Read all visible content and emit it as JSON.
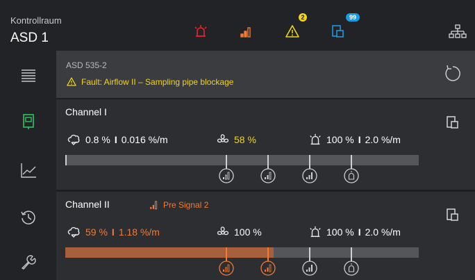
{
  "header": {
    "location": "Kontrollraum",
    "device": "ASD 1",
    "icons": [
      "alarm-icon",
      "pre-signal-icon",
      "fault-icon",
      "info-icon",
      "network-icon"
    ],
    "fault_count": "2",
    "info_count": "99",
    "colors": {
      "alarm": "#e8262a",
      "pre": "#f07b36",
      "fault": "#f2d31b",
      "info": "#1a9be0"
    }
  },
  "sidebar": {
    "items": [
      {
        "name": "menu",
        "icon": "list-icon"
      },
      {
        "name": "device",
        "icon": "detector-icon",
        "active": true
      },
      {
        "name": "chart",
        "icon": "chart-icon"
      },
      {
        "name": "history",
        "icon": "history-icon"
      },
      {
        "name": "service",
        "icon": "wrench-icon"
      }
    ]
  },
  "fault": {
    "device": "ASD 535-2",
    "message": "Fault: Airflow II – Sampling pipe blockage"
  },
  "channels": [
    {
      "title": "Channel I",
      "smoke": "0.8 %",
      "rate": "0.016 %/m",
      "airflow": "58 %",
      "alarm_level": "100 %",
      "alarm_rate": "2.0 %/m",
      "level_fraction": 0.002
    },
    {
      "title": "Channel II",
      "status": "Pre Signal 2",
      "smoke": "59 %",
      "rate": "1.18 %/m",
      "airflow": "100 %",
      "alarm_level": "100 %",
      "alarm_rate": "2.0 %/m",
      "level_fraction": 0.59
    }
  ],
  "separator": "I"
}
